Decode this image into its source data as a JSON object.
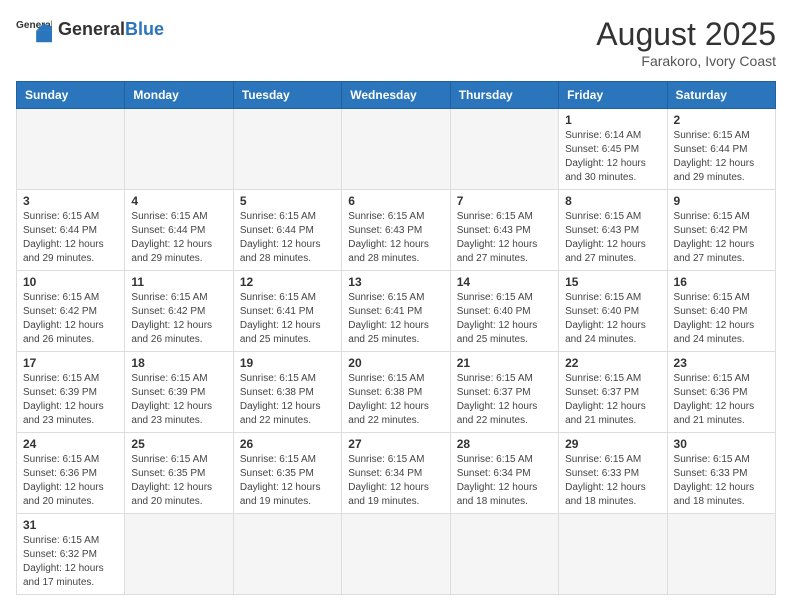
{
  "header": {
    "logo_general": "General",
    "logo_blue": "Blue",
    "month_year": "August 2025",
    "location": "Farakoro, Ivory Coast"
  },
  "columns": [
    "Sunday",
    "Monday",
    "Tuesday",
    "Wednesday",
    "Thursday",
    "Friday",
    "Saturday"
  ],
  "weeks": [
    [
      {
        "day": "",
        "info": ""
      },
      {
        "day": "",
        "info": ""
      },
      {
        "day": "",
        "info": ""
      },
      {
        "day": "",
        "info": ""
      },
      {
        "day": "",
        "info": ""
      },
      {
        "day": "1",
        "info": "Sunrise: 6:14 AM\nSunset: 6:45 PM\nDaylight: 12 hours and 30 minutes."
      },
      {
        "day": "2",
        "info": "Sunrise: 6:15 AM\nSunset: 6:44 PM\nDaylight: 12 hours and 29 minutes."
      }
    ],
    [
      {
        "day": "3",
        "info": "Sunrise: 6:15 AM\nSunset: 6:44 PM\nDaylight: 12 hours and 29 minutes."
      },
      {
        "day": "4",
        "info": "Sunrise: 6:15 AM\nSunset: 6:44 PM\nDaylight: 12 hours and 29 minutes."
      },
      {
        "day": "5",
        "info": "Sunrise: 6:15 AM\nSunset: 6:44 PM\nDaylight: 12 hours and 28 minutes."
      },
      {
        "day": "6",
        "info": "Sunrise: 6:15 AM\nSunset: 6:43 PM\nDaylight: 12 hours and 28 minutes."
      },
      {
        "day": "7",
        "info": "Sunrise: 6:15 AM\nSunset: 6:43 PM\nDaylight: 12 hours and 27 minutes."
      },
      {
        "day": "8",
        "info": "Sunrise: 6:15 AM\nSunset: 6:43 PM\nDaylight: 12 hours and 27 minutes."
      },
      {
        "day": "9",
        "info": "Sunrise: 6:15 AM\nSunset: 6:42 PM\nDaylight: 12 hours and 27 minutes."
      }
    ],
    [
      {
        "day": "10",
        "info": "Sunrise: 6:15 AM\nSunset: 6:42 PM\nDaylight: 12 hours and 26 minutes."
      },
      {
        "day": "11",
        "info": "Sunrise: 6:15 AM\nSunset: 6:42 PM\nDaylight: 12 hours and 26 minutes."
      },
      {
        "day": "12",
        "info": "Sunrise: 6:15 AM\nSunset: 6:41 PM\nDaylight: 12 hours and 25 minutes."
      },
      {
        "day": "13",
        "info": "Sunrise: 6:15 AM\nSunset: 6:41 PM\nDaylight: 12 hours and 25 minutes."
      },
      {
        "day": "14",
        "info": "Sunrise: 6:15 AM\nSunset: 6:40 PM\nDaylight: 12 hours and 25 minutes."
      },
      {
        "day": "15",
        "info": "Sunrise: 6:15 AM\nSunset: 6:40 PM\nDaylight: 12 hours and 24 minutes."
      },
      {
        "day": "16",
        "info": "Sunrise: 6:15 AM\nSunset: 6:40 PM\nDaylight: 12 hours and 24 minutes."
      }
    ],
    [
      {
        "day": "17",
        "info": "Sunrise: 6:15 AM\nSunset: 6:39 PM\nDaylight: 12 hours and 23 minutes."
      },
      {
        "day": "18",
        "info": "Sunrise: 6:15 AM\nSunset: 6:39 PM\nDaylight: 12 hours and 23 minutes."
      },
      {
        "day": "19",
        "info": "Sunrise: 6:15 AM\nSunset: 6:38 PM\nDaylight: 12 hours and 22 minutes."
      },
      {
        "day": "20",
        "info": "Sunrise: 6:15 AM\nSunset: 6:38 PM\nDaylight: 12 hours and 22 minutes."
      },
      {
        "day": "21",
        "info": "Sunrise: 6:15 AM\nSunset: 6:37 PM\nDaylight: 12 hours and 22 minutes."
      },
      {
        "day": "22",
        "info": "Sunrise: 6:15 AM\nSunset: 6:37 PM\nDaylight: 12 hours and 21 minutes."
      },
      {
        "day": "23",
        "info": "Sunrise: 6:15 AM\nSunset: 6:36 PM\nDaylight: 12 hours and 21 minutes."
      }
    ],
    [
      {
        "day": "24",
        "info": "Sunrise: 6:15 AM\nSunset: 6:36 PM\nDaylight: 12 hours and 20 minutes."
      },
      {
        "day": "25",
        "info": "Sunrise: 6:15 AM\nSunset: 6:35 PM\nDaylight: 12 hours and 20 minutes."
      },
      {
        "day": "26",
        "info": "Sunrise: 6:15 AM\nSunset: 6:35 PM\nDaylight: 12 hours and 19 minutes."
      },
      {
        "day": "27",
        "info": "Sunrise: 6:15 AM\nSunset: 6:34 PM\nDaylight: 12 hours and 19 minutes."
      },
      {
        "day": "28",
        "info": "Sunrise: 6:15 AM\nSunset: 6:34 PM\nDaylight: 12 hours and 18 minutes."
      },
      {
        "day": "29",
        "info": "Sunrise: 6:15 AM\nSunset: 6:33 PM\nDaylight: 12 hours and 18 minutes."
      },
      {
        "day": "30",
        "info": "Sunrise: 6:15 AM\nSunset: 6:33 PM\nDaylight: 12 hours and 18 minutes."
      }
    ],
    [
      {
        "day": "31",
        "info": "Sunrise: 6:15 AM\nSunset: 6:32 PM\nDaylight: 12 hours and 17 minutes."
      },
      {
        "day": "",
        "info": ""
      },
      {
        "day": "",
        "info": ""
      },
      {
        "day": "",
        "info": ""
      },
      {
        "day": "",
        "info": ""
      },
      {
        "day": "",
        "info": ""
      },
      {
        "day": "",
        "info": ""
      }
    ]
  ]
}
